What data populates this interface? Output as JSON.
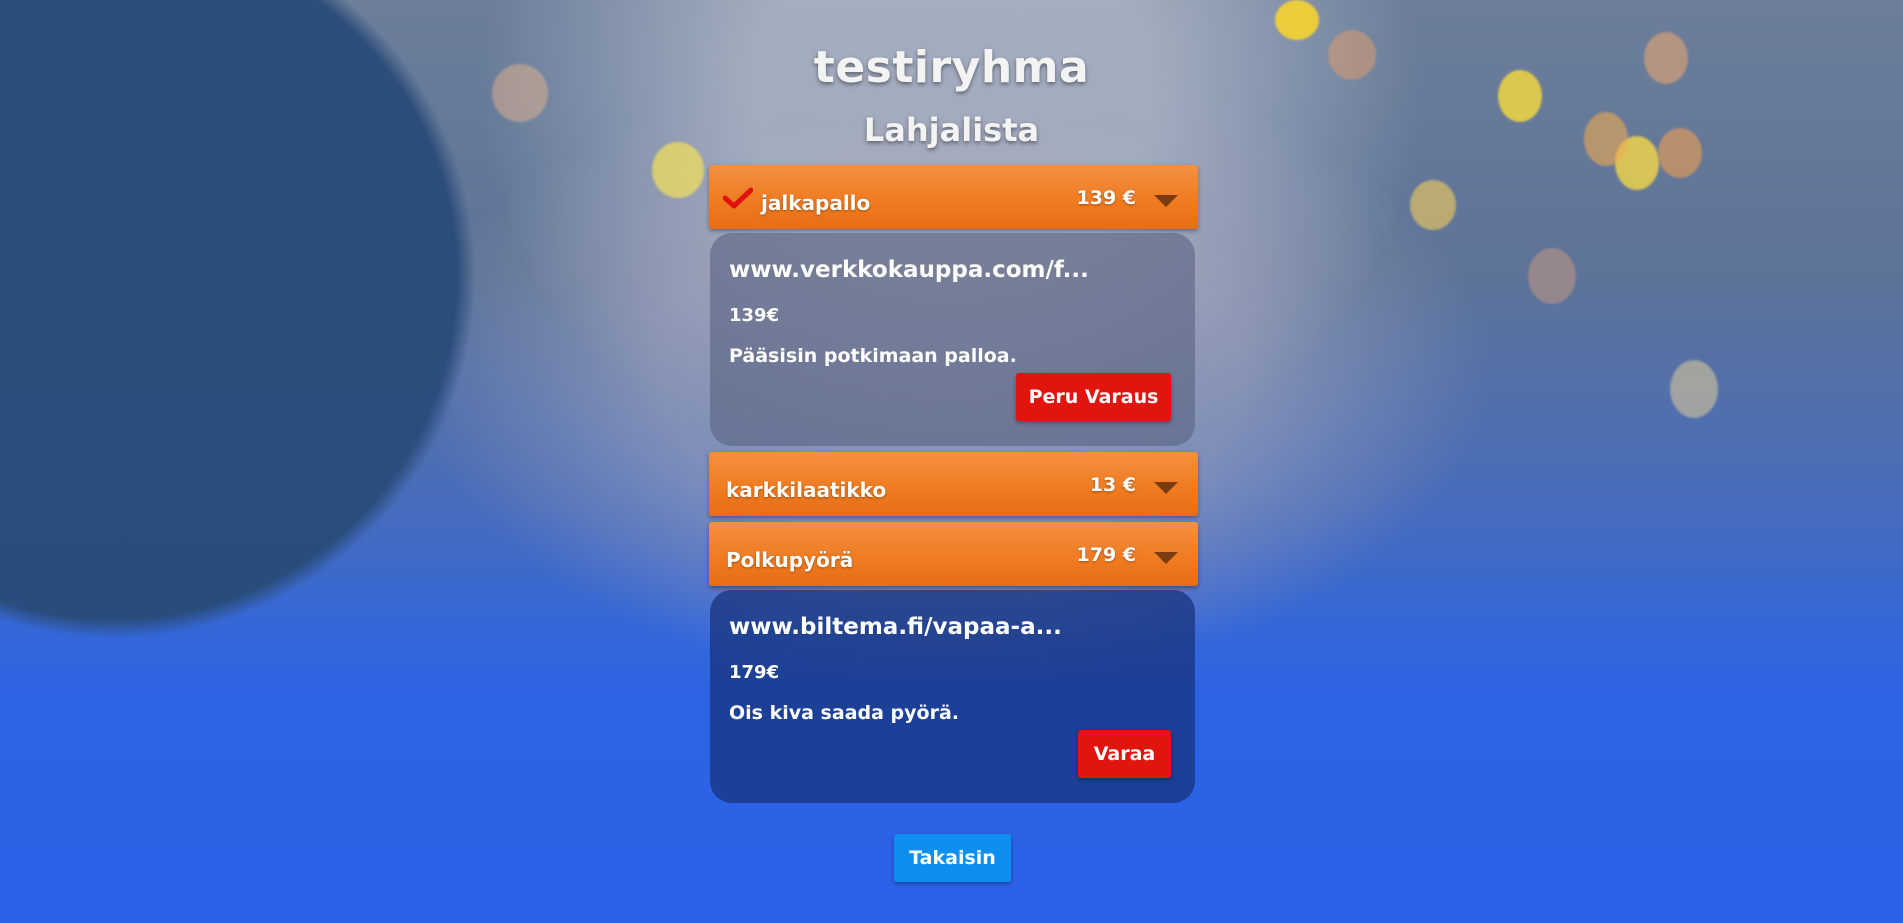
{
  "header": {
    "group_name": "testiryhma",
    "list_title": "Lahjalista"
  },
  "items": [
    {
      "name": "jalkapallo",
      "price": "139 €",
      "reserved": true,
      "expanded": true,
      "link": "www.verkkokauppa.com/f...",
      "detail_price": "139€",
      "description": "Pääsisin potkimaan palloa.",
      "action_label": "Peru Varaus"
    },
    {
      "name": "karkkilaatikko",
      "price": "13 €",
      "reserved": false,
      "expanded": false
    },
    {
      "name": "Polkupyörä",
      "price": "179 €",
      "reserved": false,
      "expanded": true,
      "link": "www.biltema.fi/vapaa-a...",
      "detail_price": "179€",
      "description": "Ois kiva saada pyörä.",
      "action_label": "Varaa"
    }
  ],
  "footer": {
    "back_label": "Takaisin"
  },
  "colors": {
    "accent_orange": "#ef7a20",
    "danger_red": "#e2150e",
    "primary_blue": "#0d8ef0",
    "page_blue": "#2a62e8"
  },
  "icons": {
    "reserved": "check-icon",
    "expand": "caret-down-icon"
  }
}
